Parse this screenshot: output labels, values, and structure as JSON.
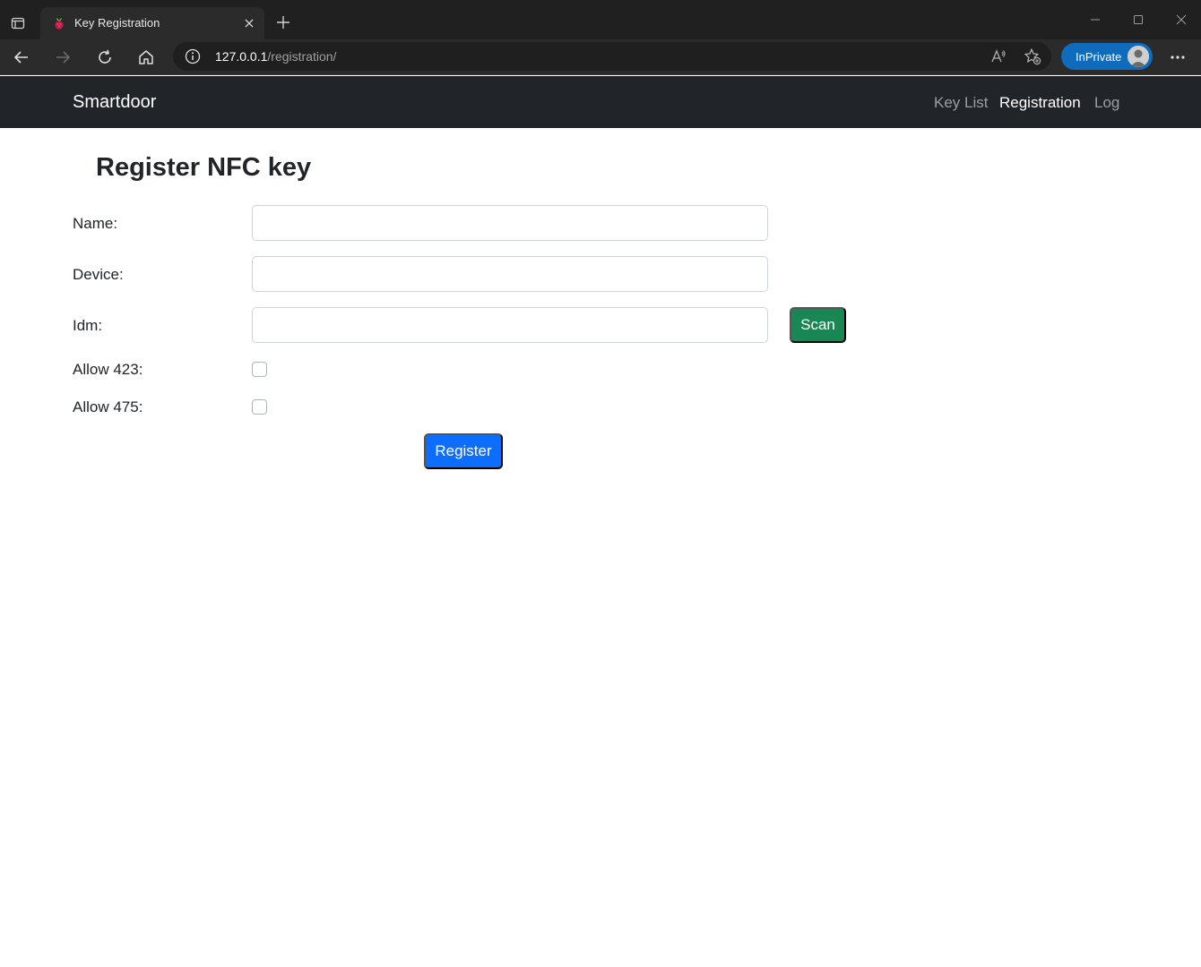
{
  "browser": {
    "tab_title": "Key Registration",
    "url_host": "127.0.0.1",
    "url_path": "/registration/",
    "inprivate_label": "InPrivate",
    "accent_color": "#0f6cbd"
  },
  "navbar": {
    "brand": "Smartdoor",
    "links": [
      {
        "label": "Key List",
        "active": false
      },
      {
        "label": "Registration",
        "active": true
      },
      {
        "label": "Log",
        "active": false
      }
    ]
  },
  "page": {
    "title": "Register NFC key",
    "fields": {
      "name_label": "Name:",
      "name_value": "",
      "device_label": "Device:",
      "device_value": "",
      "idm_label": "Idm:",
      "idm_value": "",
      "allow423_label": "Allow 423:",
      "allow423_checked": false,
      "allow475_label": "Allow 475:",
      "allow475_checked": false
    },
    "scan_button": "Scan",
    "register_button": "Register",
    "colors": {
      "scan": "#198754",
      "register": "#0d6efd",
      "navbar": "#212529"
    }
  }
}
